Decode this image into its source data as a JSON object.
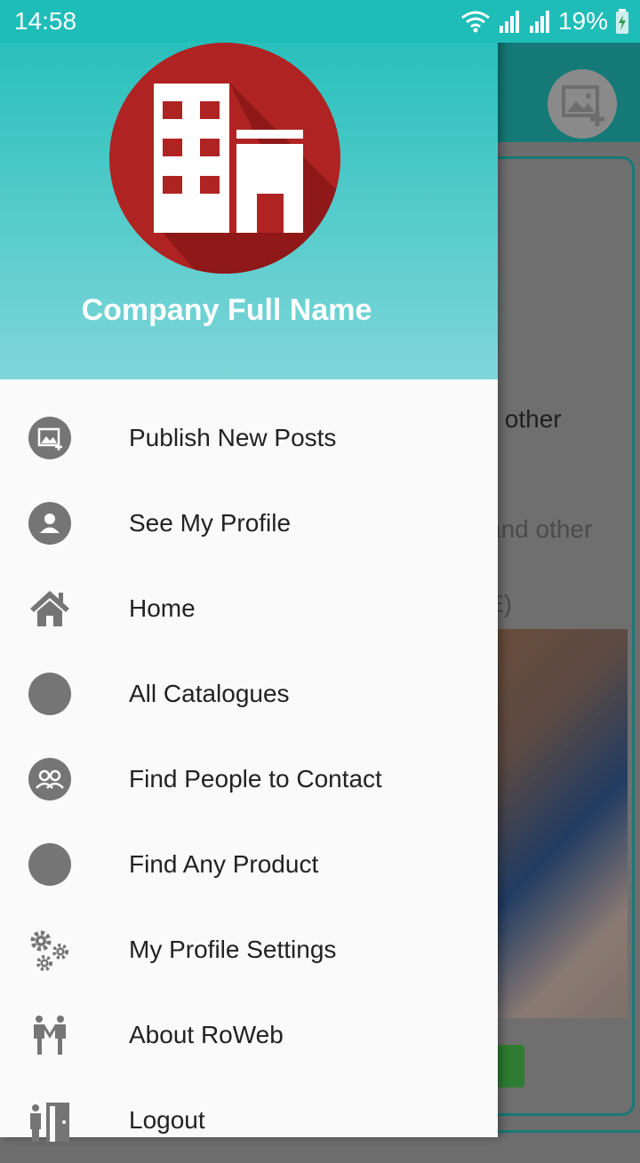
{
  "status_bar": {
    "time": "14:58",
    "battery": "19%"
  },
  "background": {
    "snippet_1": "y other",
    "snippet_2": "and other",
    "snippet_3": "E)"
  },
  "drawer": {
    "company_name": "Company Full Name",
    "menu": [
      {
        "label": "Publish New Posts",
        "icon": "image-add-icon"
      },
      {
        "label": "See My Profile",
        "icon": "user-icon"
      },
      {
        "label": "Home",
        "icon": "home-icon"
      },
      {
        "label": "All Catalogues",
        "icon": "circle-icon"
      },
      {
        "label": "Find People to Contact",
        "icon": "people-icon"
      },
      {
        "label": "Find Any Product",
        "icon": "circle-icon"
      },
      {
        "label": "My Profile Settings",
        "icon": "gears-icon"
      },
      {
        "label": "About RoWeb",
        "icon": "people-standing-icon"
      },
      {
        "label": "Logout",
        "icon": "door-exit-icon"
      }
    ]
  },
  "colors": {
    "primary": "#1ebdb8",
    "primary_dark": "#157a77",
    "logo_red": "#b02323",
    "icon_gray": "#757575"
  }
}
